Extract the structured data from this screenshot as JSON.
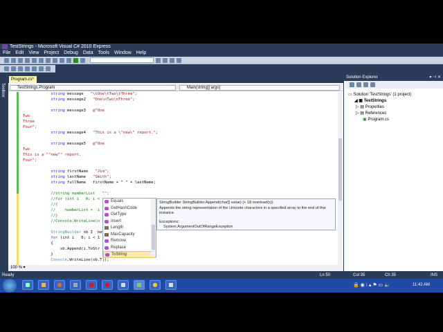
{
  "window_title": "TestStrings - Microsoft Visual C# 2010 Express",
  "menu": [
    "File",
    "Edit",
    "View",
    "Project",
    "Debug",
    "Data",
    "Tools",
    "Window",
    "Help"
  ],
  "toolbox_label": "Toolbox",
  "tab_label": "Program.cs*",
  "nav": {
    "class": "TestStrings.Program",
    "member": "Main(string[] args)"
  },
  "code": [
    [
      "k",
      "            string ",
      "",
      "message   ",
      "s",
      "\"\\tOne\\tTwo\\tThree\";"
    ],
    [
      "k",
      "            string ",
      "",
      "message2   ",
      "s",
      "\"One\\nTwo\\nThree\";"
    ],
    [
      "",
      "",
      "",
      "",
      "",
      " "
    ],
    [
      "k",
      "            string ",
      "",
      "message3   ",
      "s",
      "@\"One"
    ],
    [
      "",
      "",
      "",
      "",
      "s",
      "Two"
    ],
    [
      "",
      "",
      "",
      "",
      "s",
      "Three"
    ],
    [
      "",
      "",
      "",
      "",
      "s",
      "Four\";"
    ],
    [
      "k",
      "            string ",
      "",
      "message4   ",
      "s",
      "\"This is a \\\"new\\\" report.\";"
    ],
    [
      "",
      "",
      "",
      "",
      "",
      " "
    ],
    [
      "k",
      "            string ",
      "",
      "message5   ",
      "s",
      "@\"One"
    ],
    [
      "",
      "",
      "",
      "",
      "s",
      "Two"
    ],
    [
      "",
      "",
      "",
      "",
      "s",
      "This is a \"\"new\"\" report."
    ],
    [
      "",
      "",
      "",
      "",
      "s",
      "Four\";"
    ],
    [
      "",
      "",
      "",
      "",
      "",
      " "
    ],
    [
      "k",
      "            string ",
      "",
      "firstName   ",
      "s",
      "\"Jim\";"
    ],
    [
      "k",
      "            string ",
      "",
      "lastName   ",
      "s",
      "\"Smith\";"
    ],
    [
      "k",
      "            string ",
      "",
      "fullName   ",
      "",
      "firstName + \" \" + lastName;"
    ],
    [
      "",
      "",
      "",
      "",
      "",
      " "
    ],
    [
      "",
      "",
      "",
      "",
      "c",
      "            //string numberList   \"\";"
    ],
    [
      "",
      "",
      "",
      "",
      "c",
      "            //for (int i   0; i <"
    ],
    [
      "",
      "",
      "",
      "",
      "c",
      "            //{"
    ],
    [
      "",
      "",
      "",
      "",
      "c",
      "            //    numberList +  i"
    ],
    [
      "",
      "",
      "",
      "",
      "c",
      "            //}"
    ],
    [
      "",
      "",
      "",
      "",
      "c",
      "            //Console.WriteLine(n"
    ],
    [
      "",
      "",
      "",
      "",
      "",
      " "
    ],
    [
      "t",
      "            StringBuilder ",
      "",
      "sb ",
      "",
      "I  new"
    ],
    [
      "k",
      "            for ",
      "",
      "(int i   0; i < 1",
      "",
      ""
    ],
    [
      "",
      "",
      "",
      "",
      "",
      "            {"
    ],
    [
      "",
      "",
      "",
      "",
      "",
      "                sb.Append(i.ToStr"
    ],
    [
      "",
      "",
      "",
      "",
      "",
      "            }"
    ],
    [
      "t",
      "            Console",
      "",
      "",
      ".WriteLine(sb.T|);",
      ""
    ]
  ],
  "zoom_level": "100 %",
  "intellisense": {
    "items": [
      {
        "label": "Equals",
        "kind": "method"
      },
      {
        "label": "GetHashCode",
        "kind": "method"
      },
      {
        "label": "GetType",
        "kind": "method"
      },
      {
        "label": "Insert",
        "kind": "method"
      },
      {
        "label": "Length",
        "kind": "property"
      },
      {
        "label": "MaxCapacity",
        "kind": "property"
      },
      {
        "label": "Remove",
        "kind": "method"
      },
      {
        "label": "Replace",
        "kind": "method"
      },
      {
        "label": "ToString",
        "kind": "method",
        "selected": true
      }
    ],
    "tooltip": {
      "signature": "StringBuilder StringBuilder.Append(char[] value)  (+ 18 overload(s))",
      "description": "Appends the string representation of the Unicode characters in a specified array to the end of this instance.",
      "exceptions_label": "Exceptions:",
      "exception": "System.ArgumentOutOfRangeException"
    }
  },
  "solution_explorer": {
    "title": "Solution Explorer",
    "solution": "Solution 'TestStrings' (1 project)",
    "project": "TestStrings",
    "items": [
      "Properties",
      "References",
      "Program.cs"
    ]
  },
  "status": {
    "ready": "Ready",
    "ln": "Ln 50",
    "col": "Col 35",
    "ch": "Ch 35",
    "mode": "INS"
  },
  "clock": "11:42 AM",
  "colors": {
    "chrome": "#2b3c59",
    "keyword": "#1a1aff",
    "string": "#a31515",
    "comment": "#008000",
    "type": "#2b91af"
  }
}
